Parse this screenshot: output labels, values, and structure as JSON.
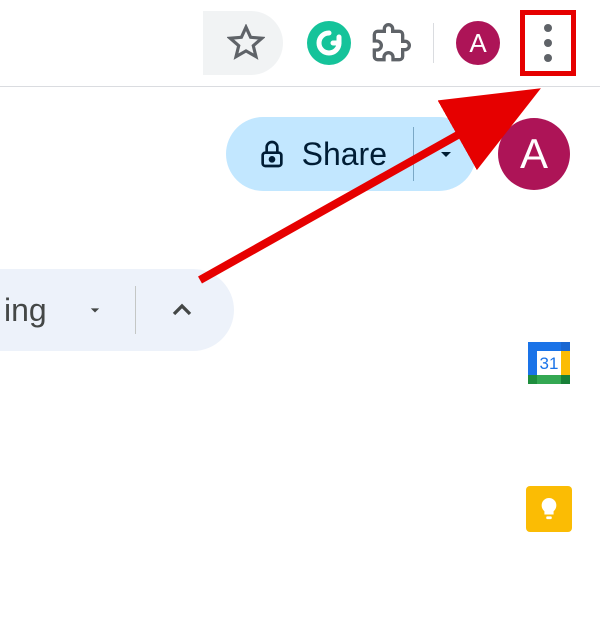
{
  "toolbar": {
    "avatar_small_initial": "A"
  },
  "share": {
    "label": "Share",
    "avatar_large_initial": "A"
  },
  "editing": {
    "label_fragment": "ing"
  },
  "side": {
    "calendar_day": "31"
  }
}
